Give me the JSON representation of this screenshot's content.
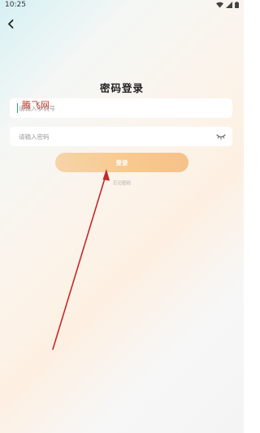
{
  "status_bar": {
    "time": "10:25"
  },
  "header": {
    "back_icon": "chevron-left-icon"
  },
  "main": {
    "title": "密码登录",
    "phone_field": {
      "placeholder": "请输入手机号",
      "value": ""
    },
    "password_field": {
      "placeholder": "请输入密码",
      "value": "",
      "toggle_icon": "eye-closed-icon"
    },
    "login_label": "登录",
    "forgot_label": "忘记密码"
  },
  "watermark": {
    "text": "腾飞网"
  },
  "colors": {
    "button_gradient_start": "#f6d4a8",
    "button_gradient_end": "#f5c28a",
    "annotation_arrow": "#c62828"
  }
}
